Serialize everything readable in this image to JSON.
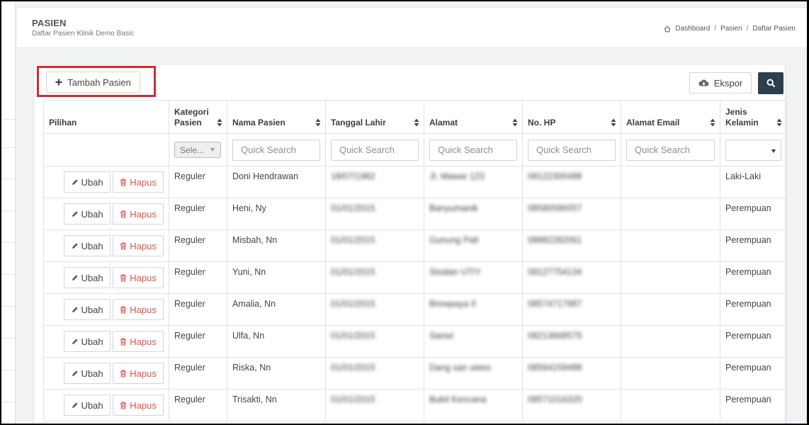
{
  "header": {
    "title": "PASIEN",
    "subtitle": "Daftar Pasien Klinik Demo Basic",
    "breadcrumb": [
      "Dashboard",
      "Pasien",
      "Daftar Pasien"
    ]
  },
  "toolbar": {
    "add_label": "Tambah Pasien",
    "export_label": "Ekspor"
  },
  "table": {
    "columns": [
      "Pilihan",
      "Kategori Pasien",
      "Nama Pasien",
      "Tanggal Lahir",
      "Alamat",
      "No. HP",
      "Alamat Email",
      "Jenis Kelamin"
    ],
    "filter": {
      "category_select": "Sele...",
      "quick_search_placeholder": "Quick Search"
    },
    "actions": {
      "edit_label": "Ubah",
      "delete_label": "Hapus"
    },
    "rows": [
      {
        "kategori": "Reguler",
        "nama": "Doni Hendrawan",
        "tgl": "18/07/1982",
        "alamat": "Jl. Mawar 123",
        "hp": "08122300488",
        "email": "",
        "jk": "Laki-Laki"
      },
      {
        "kategori": "Reguler",
        "nama": "Heni, Ny",
        "tgl": "01/01/2015",
        "alamat": "Banyumanik",
        "hp": "08580590057",
        "email": "",
        "jk": "Perempuan"
      },
      {
        "kategori": "Reguler",
        "nama": "Misbah, Nn",
        "tgl": "01/01/2015",
        "alamat": "Gunung Pati",
        "hp": "08882282061",
        "email": "",
        "jk": "Perempuan"
      },
      {
        "kategori": "Reguler",
        "nama": "Yuni, Nn",
        "tgl": "01/01/2015",
        "alamat": "Sisalan UTIY",
        "hp": "08127754134",
        "email": "",
        "jk": "Perempuan"
      },
      {
        "kategori": "Reguler",
        "nama": "Amalia, Nn",
        "tgl": "01/01/2015",
        "alamat": "Brewpaya II",
        "hp": "08574717987",
        "email": "",
        "jk": "Perempuan"
      },
      {
        "kategori": "Reguler",
        "nama": "Ulfa, Nn",
        "tgl": "01/01/2015",
        "alamat": "Sanwi",
        "hp": "08213668575",
        "email": "",
        "jk": "Perempuan"
      },
      {
        "kategori": "Reguler",
        "nama": "Riska, Nn",
        "tgl": "01/01/2015",
        "alamat": "Dang san uiees",
        "hp": "08564159488",
        "email": "",
        "jk": "Perempuan"
      },
      {
        "kategori": "Reguler",
        "nama": "Trisakti, Nn",
        "tgl": "01/01/2015",
        "alamat": "Bukit Kencana",
        "hp": "08571016320",
        "email": "",
        "jk": "Perempuan"
      }
    ]
  },
  "colors": {
    "search_button": "#2c3e50",
    "highlight_border": "#d9272e",
    "delete_text": "#d9534f"
  }
}
